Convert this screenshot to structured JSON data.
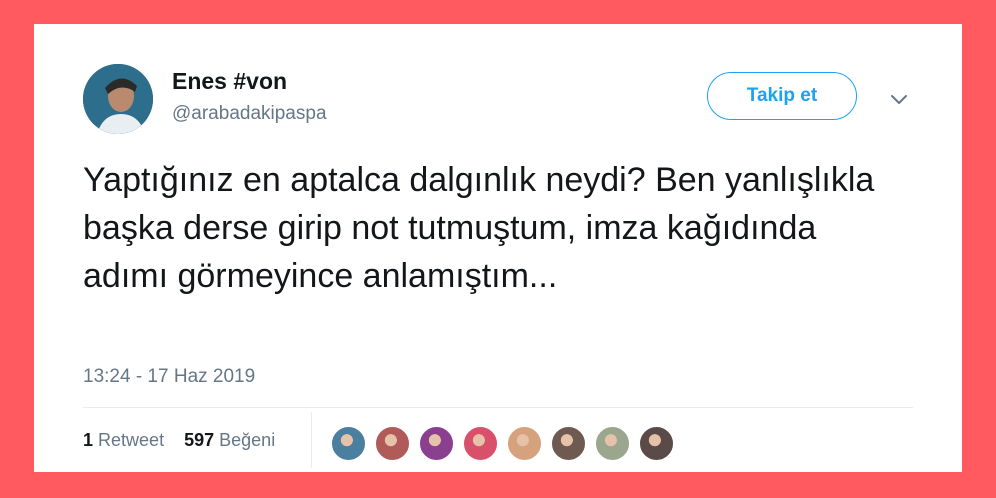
{
  "tweet": {
    "author_name": "Enes #von",
    "author_handle": "@arabadakipaspa",
    "follow_label": "Takip et",
    "text": "Yaptığınız en aptalca dalgınlık neydi? Ben yanlışlıkla başka derse girip not tutmuştum, imza kağıdında adımı görmeyince anlamıştım...",
    "timestamp": "13:24 - 17 Haz 2019"
  },
  "stats": {
    "retweet_count": "1",
    "retweet_label": "Retweet",
    "like_count": "597",
    "like_label": "Beğeni"
  },
  "likers": [
    {
      "color": "#4a7fa0"
    },
    {
      "color": "#b05a5a"
    },
    {
      "color": "#8a3f8f"
    },
    {
      "color": "#d9506b"
    },
    {
      "color": "#d6a27e"
    },
    {
      "color": "#6e5a50"
    },
    {
      "color": "#9aa68e"
    },
    {
      "color": "#5a4a48"
    }
  ],
  "colors": {
    "background": "#ff5a5f",
    "accent": "#1da1f2",
    "text": "#14171a",
    "secondary_text": "#657786"
  },
  "icons": {
    "menu": "chevron-down-icon"
  }
}
